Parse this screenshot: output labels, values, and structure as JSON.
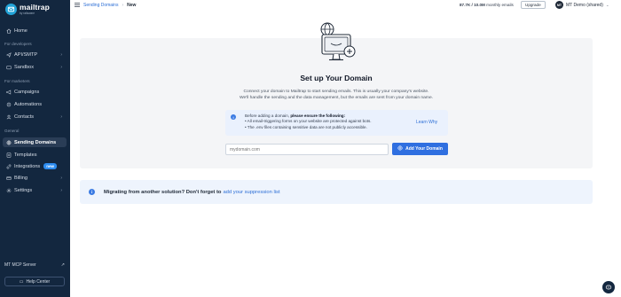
{
  "app": {
    "name": "mailtrap",
    "subtitle": "by railsware"
  },
  "sidebar": {
    "sections": {
      "developers": "For developers",
      "marketers": "For marketers",
      "general": "General"
    },
    "items": {
      "home": "Home",
      "api_smtp": "API/SMTP",
      "sandbox": "Sandbox",
      "campaigns": "Campaigns",
      "automations": "Automations",
      "contacts": "Contacts",
      "sending_domains": "Sending Domains",
      "templates": "Templates",
      "integrations": "Integrations",
      "integrations_badge": "new",
      "billing": "Billing",
      "settings": "Settings"
    },
    "mcp": "MT MCP Server",
    "help": "Help Center"
  },
  "topbar": {
    "breadcrumb_parent": "Sending Domains",
    "breadcrumb_sep": "›",
    "breadcrumb_current": "New",
    "usage_value": "87.7K / 10.0M",
    "usage_label": "monthly emails",
    "upgrade": "Upgrade",
    "account_initials": "MT",
    "account_name": "MT Demo (shared)"
  },
  "setup": {
    "title": "Set up Your Domain",
    "desc_line1": "Connect your domain to Mailtrap to start sending emails. This is usually your company's website.",
    "desc_line2": "We'll handle the sending and the data management, but the emails are sent from your domain name.",
    "info_lead": "Before adding a domain, ",
    "info_bold": "please ensure the following:",
    "info_bullet1": "• All email-triggering forms on your website are protected against bots.",
    "info_bullet2": "• The .env files containing sensitive data are not publicly accessible.",
    "learn_why": "Learn Why",
    "input_placeholder": "mydomain.com",
    "add_button": "Add Your Domain"
  },
  "banner": {
    "text": "Migrating from another solution? Don't forget to",
    "link": "add your suppression list"
  },
  "colors": {
    "sidebar": "#13273f",
    "accent": "#2f6fe0",
    "active_item": "#2a3d56"
  }
}
